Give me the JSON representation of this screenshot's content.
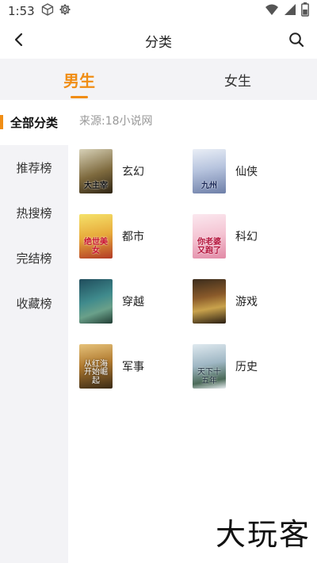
{
  "status_bar": {
    "time": "1:53",
    "left_icons": [
      "box-icon",
      "gear-icon"
    ],
    "right_icons": [
      "wifi-icon",
      "signal-icon",
      "battery-icon"
    ]
  },
  "nav": {
    "title": "分类",
    "back_icon": "chevron-left-icon",
    "search_icon": "search-icon"
  },
  "gender_tabs": [
    {
      "label": "男生",
      "active": true
    },
    {
      "label": "女生",
      "active": false
    }
  ],
  "sidebar": {
    "items": [
      {
        "label": "全部分类",
        "active": true
      },
      {
        "label": "推荐榜",
        "active": false
      },
      {
        "label": "热搜榜",
        "active": false
      },
      {
        "label": "完结榜",
        "active": false
      },
      {
        "label": "收藏榜",
        "active": false
      }
    ]
  },
  "content": {
    "source": "来源:18小说网",
    "categories": [
      {
        "name": "玄幻",
        "cover_text": "大主宰"
      },
      {
        "name": "仙侠",
        "cover_text": "九州"
      },
      {
        "name": "都市",
        "cover_text": "绝世美女"
      },
      {
        "name": "科幻",
        "cover_text": "你老婆又跑了"
      },
      {
        "name": "穿越",
        "cover_text": ""
      },
      {
        "name": "游戏",
        "cover_text": ""
      },
      {
        "name": "军事",
        "cover_text": "从红海开始崛起"
      },
      {
        "name": "历史",
        "cover_text": "天下十五年"
      }
    ]
  },
  "watermark": "大玩客",
  "colors": {
    "accent": "#f08d14",
    "side_bg": "#f3f3f6",
    "text_muted": "#999999"
  }
}
